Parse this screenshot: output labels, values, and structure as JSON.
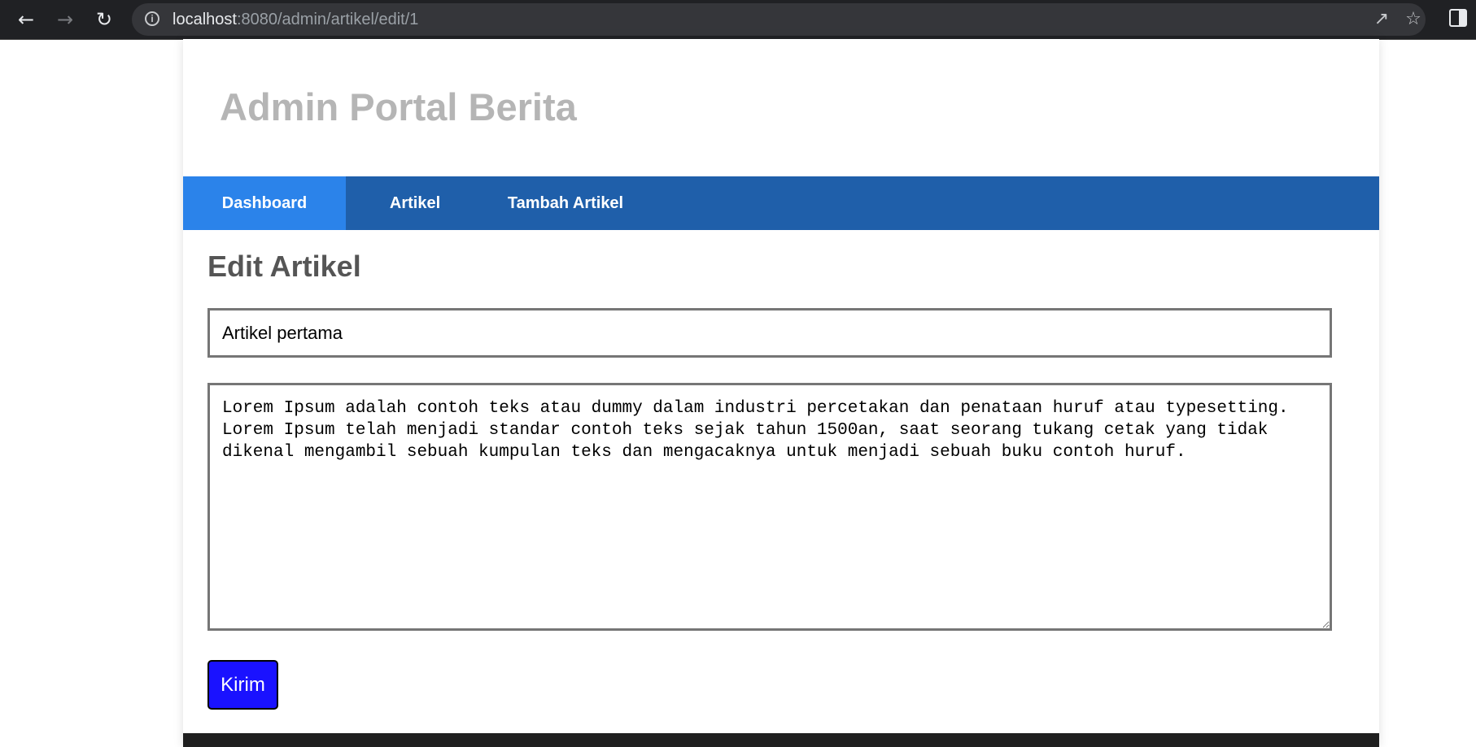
{
  "browser": {
    "url_host": "localhost",
    "url_rest": ":8080/admin/artikel/edit/1",
    "icons": {
      "back": "back-arrow-icon",
      "forward": "forward-arrow-icon",
      "reload": "reload-icon",
      "info": "site-info-icon",
      "share": "share-icon",
      "bookmark": "star-icon",
      "side_panel": "side-panel-icon"
    }
  },
  "site": {
    "title": "Admin Portal Berita"
  },
  "nav": {
    "items": [
      {
        "label": "Dashboard",
        "active": true
      },
      {
        "label": "Artikel",
        "active": false
      },
      {
        "label": "Tambah Artikel",
        "active": false
      }
    ]
  },
  "form": {
    "heading": "Edit Artikel",
    "title_value": "Artikel pertama",
    "content_value": "Lorem Ipsum adalah contoh teks atau dummy dalam industri percetakan dan penataan huruf atau typesetting.\nLorem Ipsum telah menjadi standar contoh teks sejak tahun 1500an, saat seorang tukang cetak yang tidak\ndikenal mengambil sebuah kumpulan teks dan mengacaknya untuk menjadi sebuah buku contoh huruf.",
    "submit_label": "Kirim"
  },
  "colors": {
    "nav_bg": "#1f5faa",
    "nav_active": "#2b83ea",
    "submit_bg": "#1a12ff",
    "title_color": "#b5b5b5"
  }
}
